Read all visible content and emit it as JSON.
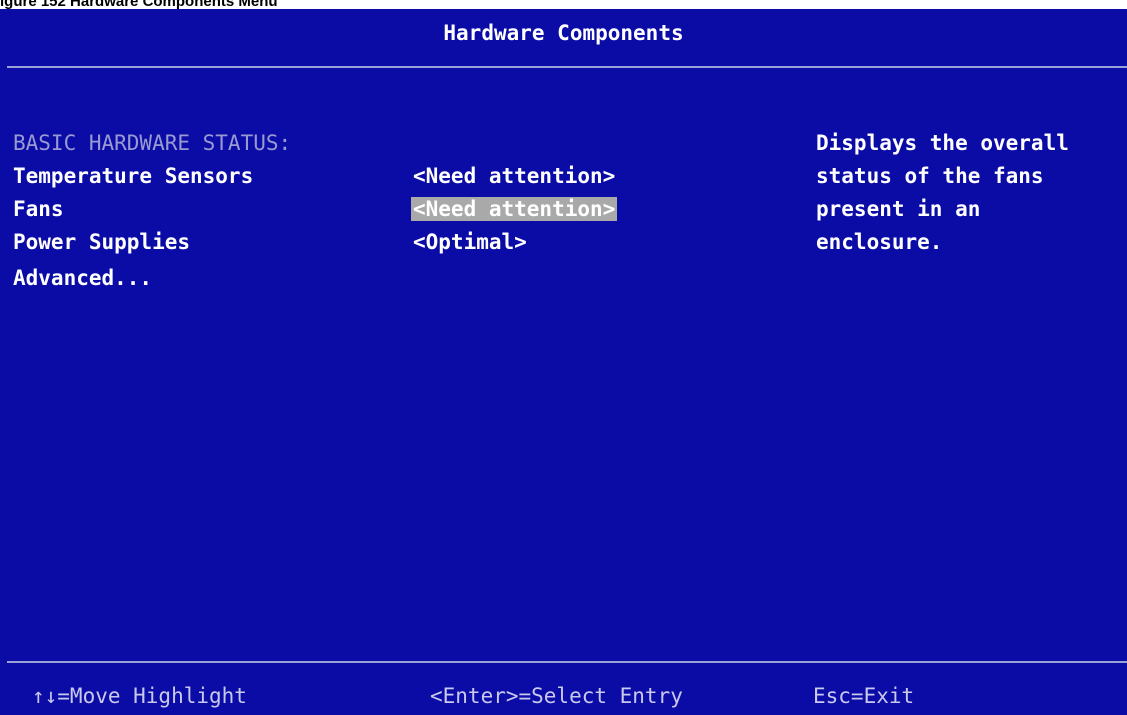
{
  "caption": "igure 152 Hardware Components Menu",
  "title": "Hardware Components",
  "section_heading": "BASIC HARDWARE STATUS:",
  "menu": [
    {
      "label": "Temperature Sensors",
      "value": "<Need attention>",
      "highlighted": false
    },
    {
      "label": "Fans",
      "value": "<Need attention>",
      "highlighted": true
    },
    {
      "label": "Power Supplies",
      "value": "<Optimal>",
      "highlighted": false
    },
    {
      "label": "Advanced...",
      "value": "",
      "highlighted": false
    }
  ],
  "help_text": [
    "Displays the overall",
    "status of the fans",
    "present in an",
    "enclosure."
  ],
  "footer": {
    "move": "↑↓=Move Highlight",
    "select": "<Enter>=Select Entry",
    "exit": "Esc=Exit"
  },
  "colors": {
    "background": "#0b0ca6",
    "highlight": "#a9a9a9",
    "heading": "#9a9ad2"
  }
}
